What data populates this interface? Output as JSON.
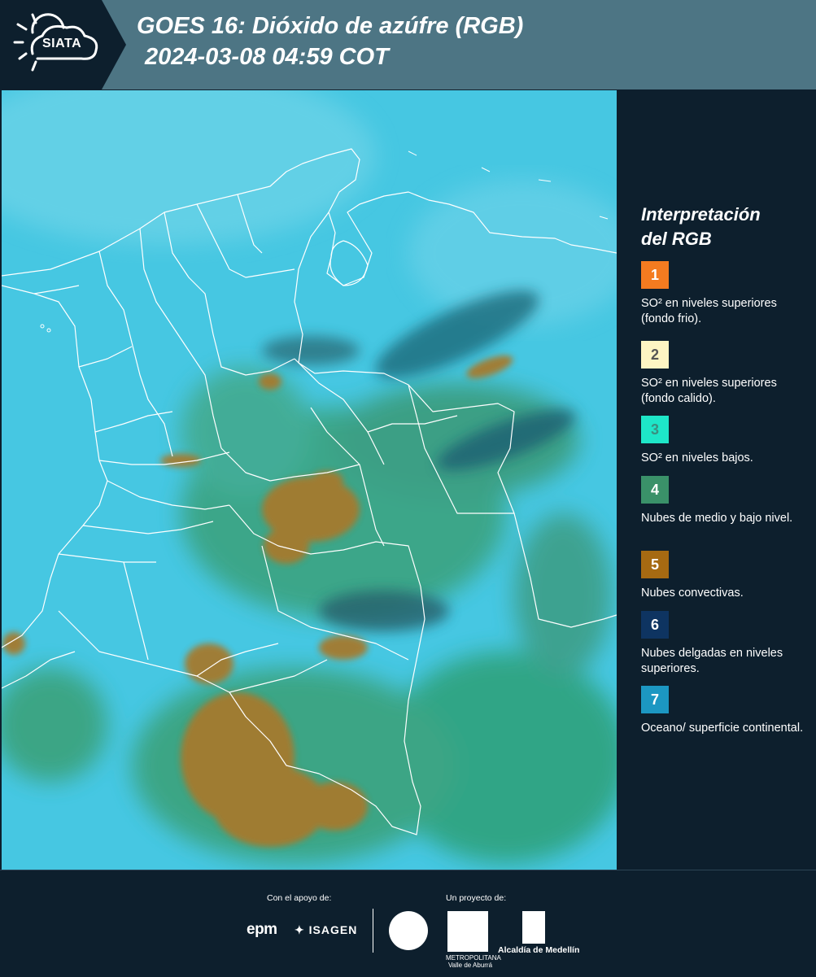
{
  "header": {
    "logo_text": "SIATA",
    "title_line1": "GOES 16: Dióxido de azúfre (RGB)",
    "title_line2": "2024-03-08 04:59 COT"
  },
  "legend": {
    "title_line1": "Interpretación",
    "title_line2": "del RGB",
    "items": [
      {
        "number": "1",
        "color": "#f47b20",
        "text": "SO² en niveles superiores (fondo frio)."
      },
      {
        "number": "2",
        "color": "#fdf5c3",
        "text": "SO² en niveles superiores (fondo calido)."
      },
      {
        "number": "3",
        "color": "#1ee6c8",
        "text": "SO² en niveles bajos."
      },
      {
        "number": "4",
        "color": "#3a9169",
        "text": "Nubes de medio y bajo nivel."
      },
      {
        "number": "5",
        "color": "#a66a12",
        "text": "Nubes convectivas."
      },
      {
        "number": "6",
        "color": "#0e3461",
        "text": "Nubes delgadas en niveles superiores."
      },
      {
        "number": "7",
        "color": "#1c97c2",
        "text": "Oceano/ superficie continental."
      }
    ]
  },
  "footer": {
    "support_label": "Con el apoyo de:",
    "project_label": "Un proyecto de:",
    "sponsor_epm": "epm",
    "sponsor_isagen": "ISAGEN",
    "area_text": "METROPOLITANA Valle de Aburrá",
    "alcaldia_text": "Alcaldía de Medellín"
  }
}
